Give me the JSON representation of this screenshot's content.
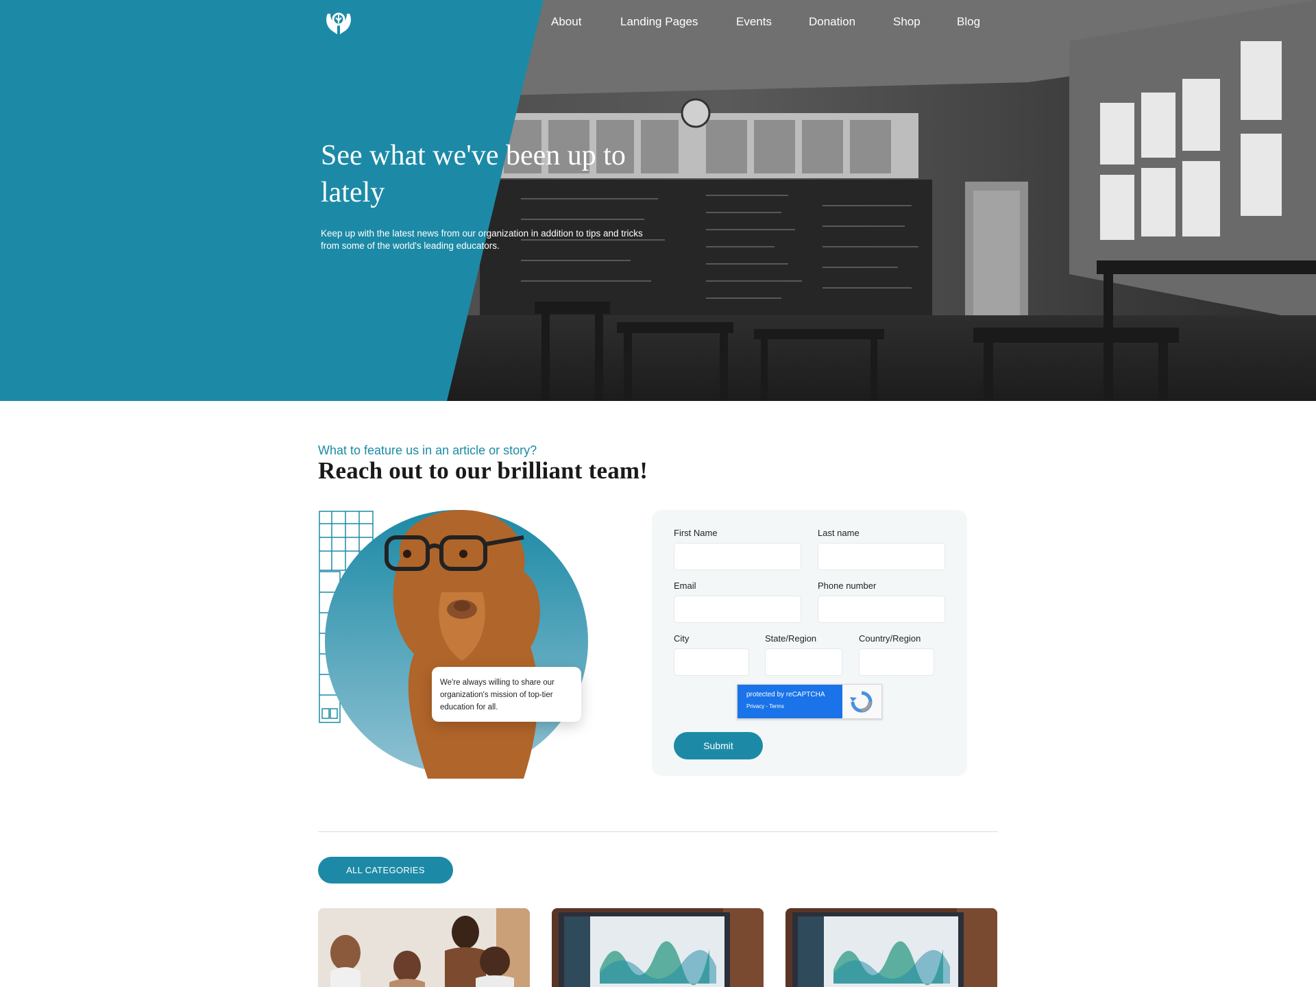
{
  "brand": {
    "logo_name": "open-book-hands-logo"
  },
  "nav": {
    "items": [
      {
        "label": "About"
      },
      {
        "label": "Landing Pages"
      },
      {
        "label": "Events"
      },
      {
        "label": "Donation"
      },
      {
        "label": "Shop"
      },
      {
        "label": "Blog"
      }
    ]
  },
  "hero": {
    "title": "See what we've been up to lately",
    "text": "Keep up with the latest news from our organization in addition to tips and tricks from some of the world's leading educators."
  },
  "contact": {
    "eyebrow": "What to feature us in an article or story?",
    "title": "Reach out to our brilliant team!",
    "callout": "We're always willing to share our organization's mission of top-tier education for all.",
    "form": {
      "first_name_label": "First Name",
      "last_name_label": "Last name",
      "email_label": "Email",
      "phone_label": "Phone number",
      "city_label": "City",
      "state_label": "State/Region",
      "country_label": "Country/Region",
      "captcha_text": "protected by reCAPTCHA",
      "captcha_links": "Privacy - Terms",
      "submit_label": "Submit"
    }
  },
  "blog": {
    "category_button": "ALL CATEGORIES"
  },
  "colors": {
    "accent": "#1c8aa6",
    "captcha_blue": "#1a73e8"
  }
}
